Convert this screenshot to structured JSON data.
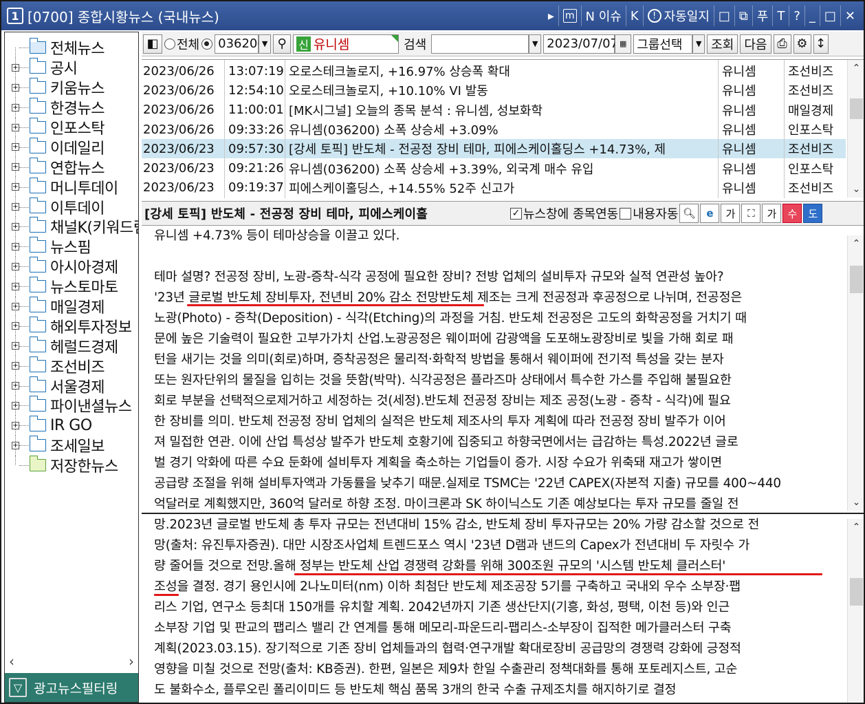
{
  "window": {
    "number": "1",
    "title": "[0700] 종합시황뉴스 (국내뉴스)",
    "tools": [
      "▸",
      "m",
      "N 이슈",
      "K",
      "자동일지",
      "□",
      "⧉",
      "푸",
      "T",
      "?",
      "_",
      "□",
      "✕"
    ]
  },
  "sidebar": {
    "items": [
      {
        "label": "전체뉴스",
        "type": "open"
      },
      {
        "label": "공시",
        "type": "folder"
      },
      {
        "label": "키움뉴스",
        "type": "folder"
      },
      {
        "label": "한경뉴스",
        "type": "folder"
      },
      {
        "label": "인포스탁",
        "type": "folder"
      },
      {
        "label": "이데일리",
        "type": "folder"
      },
      {
        "label": "연합뉴스",
        "type": "folder"
      },
      {
        "label": "머니투데이",
        "type": "folder"
      },
      {
        "label": "이투데이",
        "type": "folder"
      },
      {
        "label": "채널K(키워드림",
        "type": "folder"
      },
      {
        "label": "뉴스핌",
        "type": "folder"
      },
      {
        "label": "아시아경제",
        "type": "folder"
      },
      {
        "label": "뉴스토마토",
        "type": "folder"
      },
      {
        "label": "매일경제",
        "type": "folder"
      },
      {
        "label": "해외투자정보",
        "type": "folder"
      },
      {
        "label": "헤럴드경제",
        "type": "folder"
      },
      {
        "label": "조선비즈",
        "type": "folder"
      },
      {
        "label": "서울경제",
        "type": "folder"
      },
      {
        "label": "파이낸셜뉴스",
        "type": "folder"
      },
      {
        "label": "IR GO",
        "type": "folder"
      },
      {
        "label": "조세일보",
        "type": "folder"
      },
      {
        "label": "저장한뉴스",
        "type": "green"
      }
    ],
    "ad_filter_label": "광고뉴스필터링"
  },
  "toolbar": {
    "radio_all": "전체",
    "code": "036200",
    "badge": "신",
    "stock_name": "유니셈",
    "search_label": "검색",
    "search_value": "",
    "date": "2023/07/07",
    "group_select": "그룹선택",
    "query_btn": "조회",
    "next_btn": "다음"
  },
  "news_list": [
    {
      "date": "2023/06/26",
      "time": "13:07:19",
      "title": "오로스테크놀로지, +16.97% 상승폭 확대",
      "stock": "유니셈",
      "source": "조선비즈",
      "selected": false
    },
    {
      "date": "2023/06/26",
      "time": "12:54:10",
      "title": "오로스테크놀로지, +10.10% VI 발동",
      "stock": "유니셈",
      "source": "조선비즈",
      "selected": false
    },
    {
      "date": "2023/06/26",
      "time": "11:00:01",
      "title": "[MK시그널] 오늘의 종목 분석 : 유니셈, 성보화학",
      "stock": "유니셈",
      "source": "매일경제",
      "selected": false
    },
    {
      "date": "2023/06/26",
      "time": "09:33:26",
      "title": "유니셈(036200) 소폭 상승세 +3.09%",
      "stock": "유니셈",
      "source": "인포스탁",
      "selected": false
    },
    {
      "date": "2023/06/23",
      "time": "09:57:30",
      "title": "[강세 토픽] 반도체 - 전공정 장비 테마, 피에스케이홀딩스 +14.73%, 제",
      "stock": "유니셈",
      "source": "조선비즈",
      "selected": true
    },
    {
      "date": "2023/06/23",
      "time": "09:21:26",
      "title": "유니셈(036200) 소폭 상승세 +3.39%, 외국계 매수 유입",
      "stock": "유니셈",
      "source": "인포스탁",
      "selected": false
    },
    {
      "date": "2023/06/23",
      "time": "09:19:37",
      "title": "피에스케이홀딩스, +14.55% 52주 신고가",
      "stock": "유니셈",
      "source": "조선비즈",
      "selected": false
    }
  ],
  "detail": {
    "title": "[강세 토픽] 반도체 - 전공정 장비 테마, 피에스케이홀",
    "link_label": "뉴스창에 종목연동",
    "auto_label": "내용자동",
    "btn_su": "수",
    "btn_do": "도"
  },
  "article_top": [
    "유니셈 +4.73% 등이 테마상승을 이끌고 있다.",
    "",
    "테마 설명? 전공정 장비, 노광-증착-식각 공정에 필요한 장비? 전방 업체의 설비투자 규모와 실적 연관성 높아?",
    "'23년 글로벌 반도체 장비투자, 전년비 20% 감소 전망반도체 제조는 크게 전공정과 후공정으로 나뉘며, 전공정은",
    "노광(Photo) - 증착(Deposition) - 식각(Etching)의 과정을 거침. 반도체 전공정은 고도의 화학공정을 거치기 때",
    "문에 높은 기술력이 필요한 고부가가치 산업.노광공정은 웨이퍼에 감광액을 도포해노광장비로 빛을 가해 회로 패",
    "턴을 새기는 것을 의미(회로)하며, 증착공정은 물리적·화학적 방법을 통해서 웨이퍼에 전기적 특성을 갖는 분자",
    "또는 원자단위의 물질을 입히는 것을 뜻함(박막). 식각공정은 플라즈마 상태에서 특수한 가스를 주입해 불필요한",
    "회로 부분을 선택적으로제거하고 세정하는 것(세정).반도체 전공정 장비는 제조 공정(노광 - 증착 - 식각)에 필요",
    "한 장비를 의미. 반도체 전공정 장비 업체의 실적은 반도체 제조사의 투자 계획에 따라 전공정 장비 발주가 이어",
    "져 밀접한 연관. 이에 산업 특성상 발주가 반도체 호황기에 집중되고 하향국면에서는 급감하는 특성.2022년 글로",
    "벌 경기 악화에 따른 수요 둔화에 설비투자 계획을 축소하는 기업들이 증가. 시장 수요가 위축돼 재고가 쌓이면",
    "공급량 조절을 위해 설비투자액과 가동률을 낮추기 때문.실제로 TSMC는 '22년 CAPEX(자본적 지출) 규모를 400~440",
    "억달러로 계획했지만, 360억 달러로 하향 조정. 마이크론과 SK 하이닉스도 기존 예상보다는 투자 규모를 줄일 전"
  ],
  "article_bottom": [
    "망.2023년 글로벌 반도체 총 투자 규모는 전년대비 15% 감소, 반도체 장비 투자규모는 20% 가량 감소할 것으로 전",
    "망(출처: 유진투자증권). 대만 시장조사업체 트렌드포스 역시 '23년 D램과 낸드의 Capex가 전년대비 두 자릿수 가",
    "량 줄어들 것으로 전망.올해 정부는 반도체 산업 경쟁력 강화를 위해 300조원 규모의 '시스템 반도체 클러스터'",
    "조성을 결정. 경기 용인시에 2나노미터(nm) 이하 최첨단 반도체 제조공장 5기를 구축하고 국내외 우수 소부장·팹",
    "리스 기업, 연구소 등최대 150개를 유치할 계획. 2042년까지 기존 생산단지(기흥, 화성, 평택, 이천 등)와 인근",
    "소부장 기업 및 판교의 팹리스 밸리 간 연계를 통해 메모리-파운드리-팹리스-소부장이 집적한 메가클러스터 구축",
    "계획(2023.03.15). 장기적으로 기존 장비 업체들과의 협력·연구개발 확대로장비 공급망의 경쟁력 강화에 긍정적",
    "영향을 미칠 것으로 전망(출처: KB증권). 한편, 일본은 제9차 한일 수출관리 정책대화를 통해 포토레지스트, 고순",
    "도 불화수소, 플루오린 폴리이미드 등 반도체 핵심 품목 3개의 한국 수출 규제조치를 해지하기로 결정"
  ],
  "colors": {
    "title_bar": "#2f5196",
    "selected_row": "#cde6f2",
    "underline": "#e21818",
    "ad_filter_bg": "#2d7a6e"
  }
}
